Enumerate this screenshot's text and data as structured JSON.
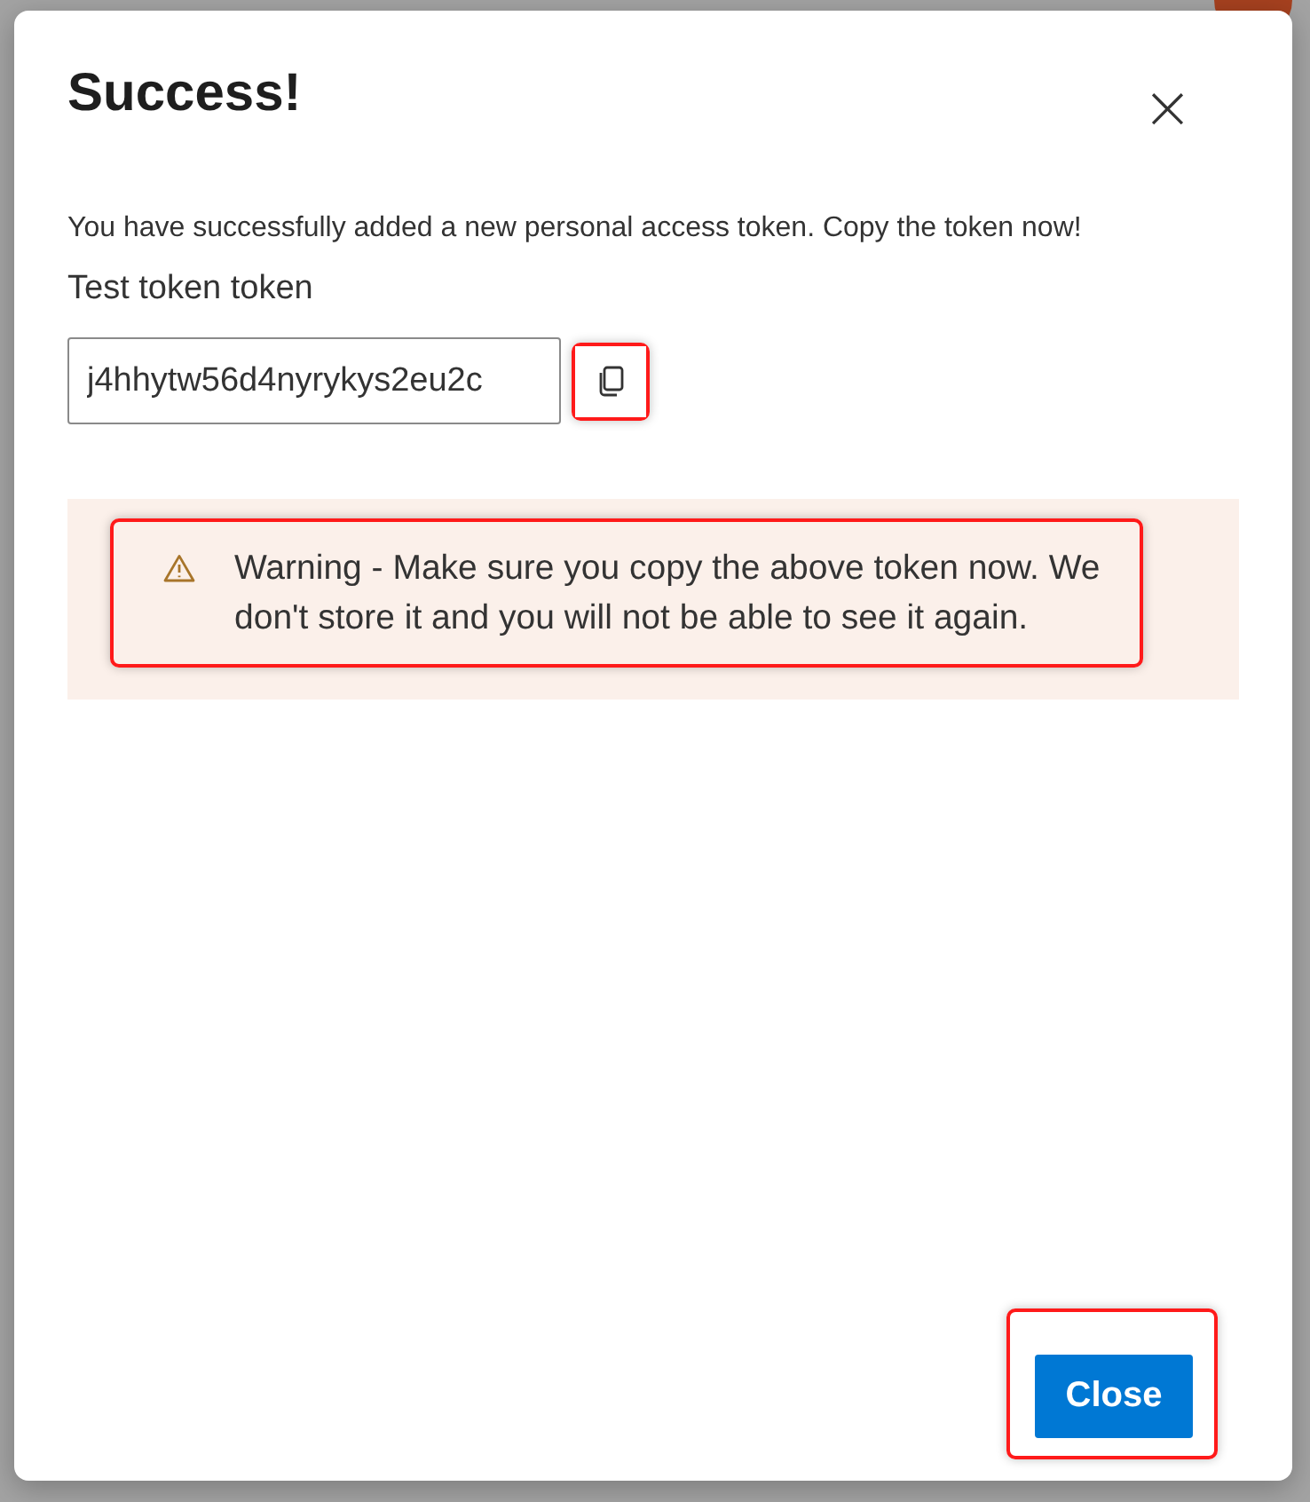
{
  "dialog": {
    "title": "Success!",
    "close_icon": "×",
    "message": "You have successfully added a new personal access token. Copy the token now!",
    "token_label": "Test token token",
    "token_value": "j4hhytw56d4nyrykys2eu2c",
    "copy_button": {
      "highlighted": true
    },
    "warning": {
      "text": "Warning - Make sure you copy the above token now. We don't store it and you will not be able to see it again.",
      "highlighted": true
    },
    "close_button": {
      "label": "Close",
      "highlighted": true
    }
  }
}
